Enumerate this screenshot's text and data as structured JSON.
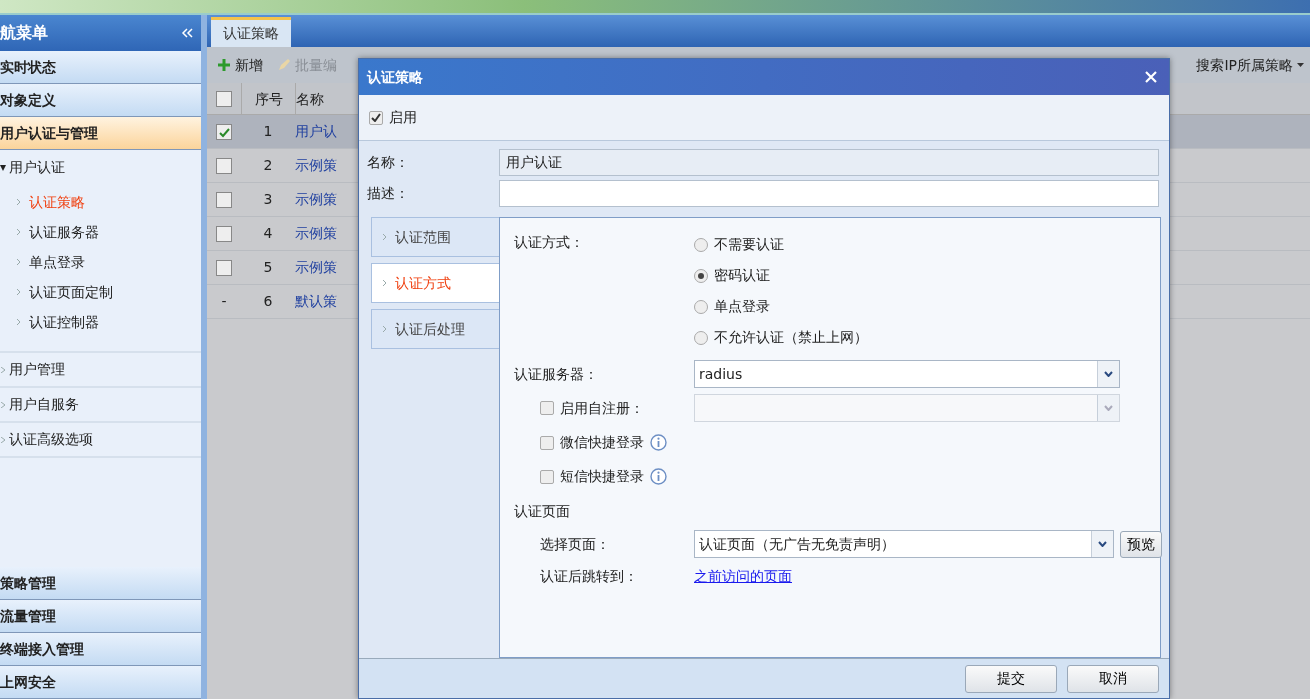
{
  "sidebar": {
    "title": "航菜单",
    "top_sections": [
      {
        "label": "实时状态",
        "selected": false
      },
      {
        "label": "对象定义",
        "selected": false
      },
      {
        "label": "用户认证与管理",
        "selected": true
      }
    ],
    "tree": [
      {
        "label": "用户认证",
        "expanded": true,
        "children": [
          {
            "label": "认证策略",
            "selected": true
          },
          {
            "label": "认证服务器",
            "selected": false
          },
          {
            "label": "单点登录",
            "selected": false
          },
          {
            "label": "认证页面定制",
            "selected": false
          },
          {
            "label": "认证控制器",
            "selected": false
          }
        ]
      },
      {
        "label": "用户管理",
        "expanded": false
      },
      {
        "label": "用户自服务",
        "expanded": false
      },
      {
        "label": "认证高级选项",
        "expanded": false
      }
    ],
    "bottom_sections": [
      {
        "label": "策略管理",
        "selected": false
      },
      {
        "label": "流量管理",
        "selected": false
      },
      {
        "label": "终端接入管理",
        "selected": false
      },
      {
        "label": "上网安全",
        "selected": false
      }
    ]
  },
  "main": {
    "tabs": [
      {
        "label": "认证策略",
        "selected": true
      }
    ],
    "toolbar": [
      {
        "kind": "add",
        "label": "新增",
        "disabled": false
      },
      {
        "kind": "edit",
        "label": "批量编",
        "disabled": true
      }
    ],
    "search_menu": "搜索IP所属策略",
    "table": {
      "select_all_checked": false,
      "columns": [
        "序号",
        "名称"
      ],
      "rows": [
        {
          "kind": "check",
          "checked": true,
          "selected": true,
          "index": "1",
          "name": "用户认"
        },
        {
          "kind": "check",
          "checked": false,
          "selected": false,
          "index": "2",
          "name": "示例策"
        },
        {
          "kind": "check",
          "checked": false,
          "selected": false,
          "index": "3",
          "name": "示例策"
        },
        {
          "kind": "check",
          "checked": false,
          "selected": false,
          "index": "4",
          "name": "示例策"
        },
        {
          "kind": "check",
          "checked": false,
          "selected": false,
          "index": "5",
          "name": "示例策"
        },
        {
          "kind": "fixed",
          "marker": "-",
          "selected": false,
          "index": "6",
          "name": "默认策"
        }
      ]
    }
  },
  "dialog": {
    "title": "认证策略",
    "enabled": {
      "label": "启用",
      "checked": true
    },
    "name": {
      "label": "名称：",
      "value": "用户认证"
    },
    "description": {
      "label": "描述："
    },
    "side_tabs": [
      {
        "label": "认证范围",
        "selected": false
      },
      {
        "label": "认证方式",
        "selected": true
      },
      {
        "label": "认证后处理",
        "selected": false
      }
    ],
    "auth_method": {
      "label": "认证方式：",
      "options": [
        {
          "label": "不需要认证",
          "selected": false
        },
        {
          "label": "密码认证",
          "selected": true
        },
        {
          "label": "单点登录",
          "selected": false
        },
        {
          "label": "不允许认证（禁止上网）",
          "selected": false
        }
      ]
    },
    "auth_server": {
      "label": "认证服务器：",
      "value": "radius"
    },
    "self_register": {
      "label": "启用自注册：",
      "checked": false
    },
    "quick_logins": [
      {
        "label": "微信快捷登录",
        "checked": false
      },
      {
        "label": "短信快捷登录",
        "checked": false
      }
    ],
    "page_section": {
      "title": "认证页面",
      "select_label": "选择页面：",
      "select_value": "认证页面（无广告无免责声明）",
      "preview_button": "预览",
      "redirect_label": "认证后跳转到：",
      "redirect_link": "之前访问的页面"
    },
    "buttons": [
      "提交",
      "取消"
    ]
  }
}
